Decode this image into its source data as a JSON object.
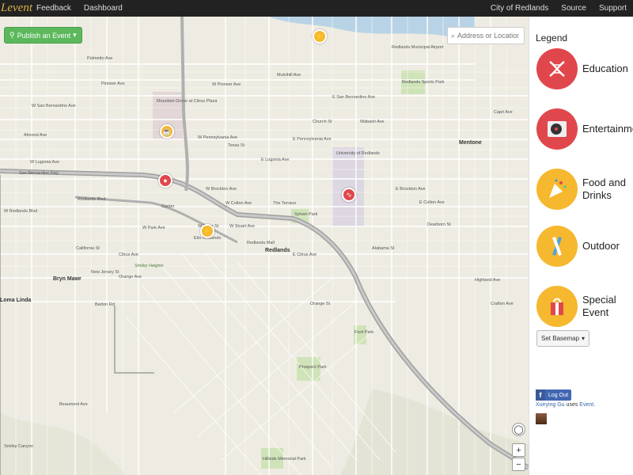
{
  "nav": {
    "brand": "Levent",
    "left_links": [
      "Feedback",
      "Dashboard"
    ],
    "right_links": [
      "City of Redlands",
      "Source",
      "Support"
    ]
  },
  "map": {
    "publish_button": "Publish an Event",
    "search_placeholder": "Address or Location",
    "zoom_in": "+",
    "zoom_out": "−",
    "town_labels": [
      "Redlands",
      "Mentone",
      "Bryn Mawr",
      "Loma Linda"
    ],
    "place_labels": [
      "Mountain Grove at Citrus Plaza",
      "University of Redlands",
      "Redlands Mall",
      "Redlands Municipal Airport",
      "Redlands Sports Park",
      "Sylvan Park",
      "Prospect Park",
      "Hillside Memorial Park",
      "Ford Park",
      "Elm Redlands",
      "Center",
      "Smiley Heights"
    ],
    "street_labels": [
      "Palmetto Ave",
      "Pioneer Ave",
      "W Pioneer Ave",
      "W San Bernardino Ave",
      "Almond Ave",
      "W Lugonia Ave",
      "W Pennsylvania Ave",
      "E Pennsylvania Ave",
      "E Lugonia Ave",
      "W Brockton Ave",
      "E Brockton Ave",
      "W Redlands Blvd",
      "Redlands Blvd",
      "W Colton Ave",
      "E Colton Ave",
      "W State St",
      "W Stuart Ave",
      "W Park Ave",
      "Citrus Ave",
      "E Citrus Ave",
      "Orange Ave",
      "Barton Rd",
      "Beaumont Ave",
      "Smiley Canyon",
      "Mulvihill Ave",
      "E San Bernardino Ave",
      "Capri Ave",
      "Highland Ave",
      "The Terrace",
      "San Bernardino Fwy",
      "Crafton Ave",
      "Wabash Ave",
      "Church St",
      "Dearborn St",
      "California St",
      "New Jersey St",
      "Alabama St",
      "Texas St",
      "Orange St"
    ],
    "markers": [
      {
        "category": "Outdoor",
        "icon": "lightning-icon",
        "color": "#f5b82e"
      },
      {
        "category": "Food and Drinks",
        "icon": "cup-icon",
        "color": "#f5b82e"
      },
      {
        "category": "Entertainment",
        "icon": "record-player-icon",
        "color": "#e0474c"
      },
      {
        "category": "Education",
        "icon": "dna-icon",
        "color": "#e0474c"
      },
      {
        "category": "Outdoor",
        "icon": "lightning-icon",
        "color": "#f5b82e"
      }
    ]
  },
  "legend": {
    "title": "Legend",
    "items": [
      {
        "label": "Education",
        "color": "#e0474c",
        "icon": "dna-icon"
      },
      {
        "label": "Entertainment",
        "color": "#e0474c",
        "icon": "record-player-icon"
      },
      {
        "label": "Food and Drinks",
        "color": "#f5b82e",
        "icon": "party-icon"
      },
      {
        "label": "Outdoor",
        "color": "#f5b82e",
        "icon": "outdoor-icon"
      },
      {
        "label": "Special Event",
        "color": "#f5b82e",
        "icon": "gift-bag-icon"
      }
    ],
    "basemap_button": "Set Basemap",
    "logout_button": "Log Out",
    "user_name": "Xueying Gu",
    "uses_text": "uses",
    "app_link": "Event."
  }
}
